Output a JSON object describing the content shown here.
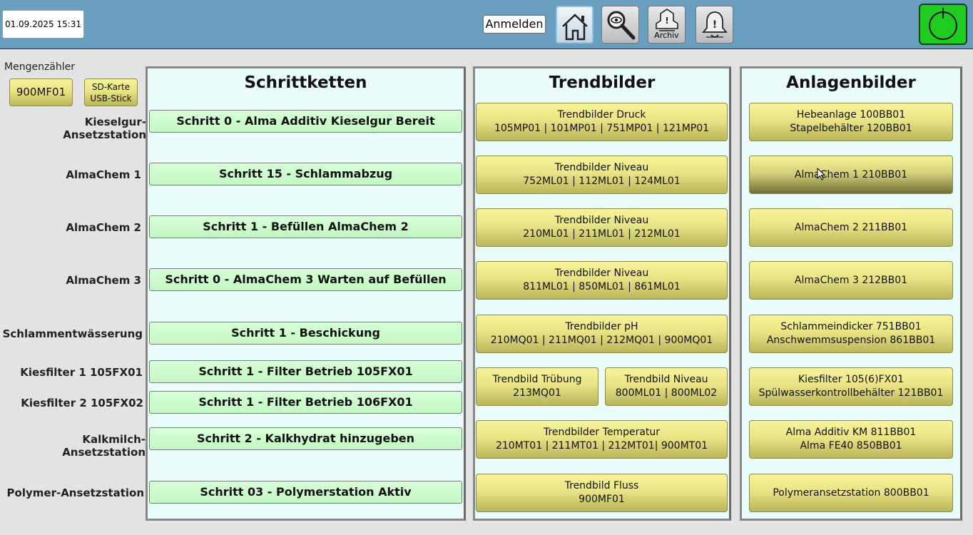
{
  "header": {
    "datetime": "01.09.2025 15:31",
    "login_label": "Anmelden",
    "nav": [
      {
        "id": "home",
        "icon": "home-icon",
        "label": ""
      },
      {
        "id": "search",
        "icon": "magnifier-icon",
        "label": ""
      },
      {
        "id": "archive",
        "icon": "alarm-archive-icon",
        "label": "Archiv"
      },
      {
        "id": "alarms",
        "icon": "alarm-bell-icon",
        "label": ""
      }
    ],
    "power_icon": "power-icon",
    "power_color": "#1fcc1f"
  },
  "counter": {
    "label": "Mengenzähler",
    "btn_900": "900MF01",
    "sd_line1": "SD-Karte",
    "sd_line2": "USB-Stick"
  },
  "rows": [
    {
      "label": "Kieselgur-Ansetzstation",
      "step": "Schritt 0 - Alma Additiv Kieselgur Bereit"
    },
    {
      "label": "AlmaChem 1",
      "step": "Schritt 15 - Schlammabzug"
    },
    {
      "label": "AlmaChem 2",
      "step": "Schritt 1 - Befüllen AlmaChem 2"
    },
    {
      "label": "AlmaChem 3",
      "step": "Schritt 0 - AlmaChem 3 Warten auf Befüllen"
    },
    {
      "label": "Schlammentwässerung",
      "step": "Schritt 1 - Beschickung"
    },
    {
      "label": "Kiesfilter 1 105FX01",
      "step": "Schritt 1 - Filter Betrieb 105FX01"
    },
    {
      "label": "Kiesfilter 2 105FX02",
      "step": "Schritt 1 - Filter Betrieb 106FX01"
    },
    {
      "label": "Kalkmilch-Ansetzstation",
      "step": "Schritt 2 - Kalkhydrat hinzugeben"
    },
    {
      "label": "Polymer-Ansetzstation",
      "step": "Schritt 03 - Polymerstation Aktiv"
    }
  ],
  "panels": {
    "schrittketten": "Schrittketten",
    "trendbilder": "Trendbilder",
    "anlagenbilder": "Anlagenbilder"
  },
  "trends": [
    {
      "l1": "Trendbilder Druck",
      "l2": "105MP01 | 101MP01 | 751MP01 | 121MP01"
    },
    {
      "l1": "Trendbilder Niveau",
      "l2": "752ML01 | 112ML01 | 124ML01"
    },
    {
      "l1": "Trendbilder Niveau",
      "l2": "210ML01 | 211ML01 | 212ML01"
    },
    {
      "l1": "Trendbilder Niveau",
      "l2": "811ML01 | 850ML01 | 861ML01"
    },
    {
      "l1": "Trendbilder pH",
      "l2": "210MQ01 | 211MQ01 | 212MQ01 | 900MQ01"
    },
    {
      "l1": "Trendbild Trübung",
      "l2": "213MQ01"
    },
    {
      "l1": "Trendbild Niveau",
      "l2": "800ML01 | 800ML02"
    },
    {
      "l1": "Trendbilder Temperatur",
      "l2": "210MT01 | 211MT01 | 212MT01| 900MT01"
    },
    {
      "l1": "Trendbild Fluss",
      "l2": "900MF01"
    }
  ],
  "plants": [
    {
      "l1": "Hebeanlage 100BB01",
      "l2": "Stapelbehälter 120BB01"
    },
    {
      "l1": "AlmaChem 1 210BB01",
      "l2": ""
    },
    {
      "l1": "AlmaChem 2 211BB01",
      "l2": ""
    },
    {
      "l1": "AlmaChem 3 212BB01",
      "l2": ""
    },
    {
      "l1": "Schlammeindicker 751BB01",
      "l2": "Anschwemmsuspension 861BB01"
    },
    {
      "l1": "Kiesfilter 105(6)FX01",
      "l2": "Spülwasserkontrollbehälter 121BB01"
    },
    {
      "l1": "Alma Additiv KM 811BB01",
      "l2": "Alma FE40 850BB01"
    },
    {
      "l1": "Polymeransetzstation 800BB01",
      "l2": ""
    }
  ]
}
